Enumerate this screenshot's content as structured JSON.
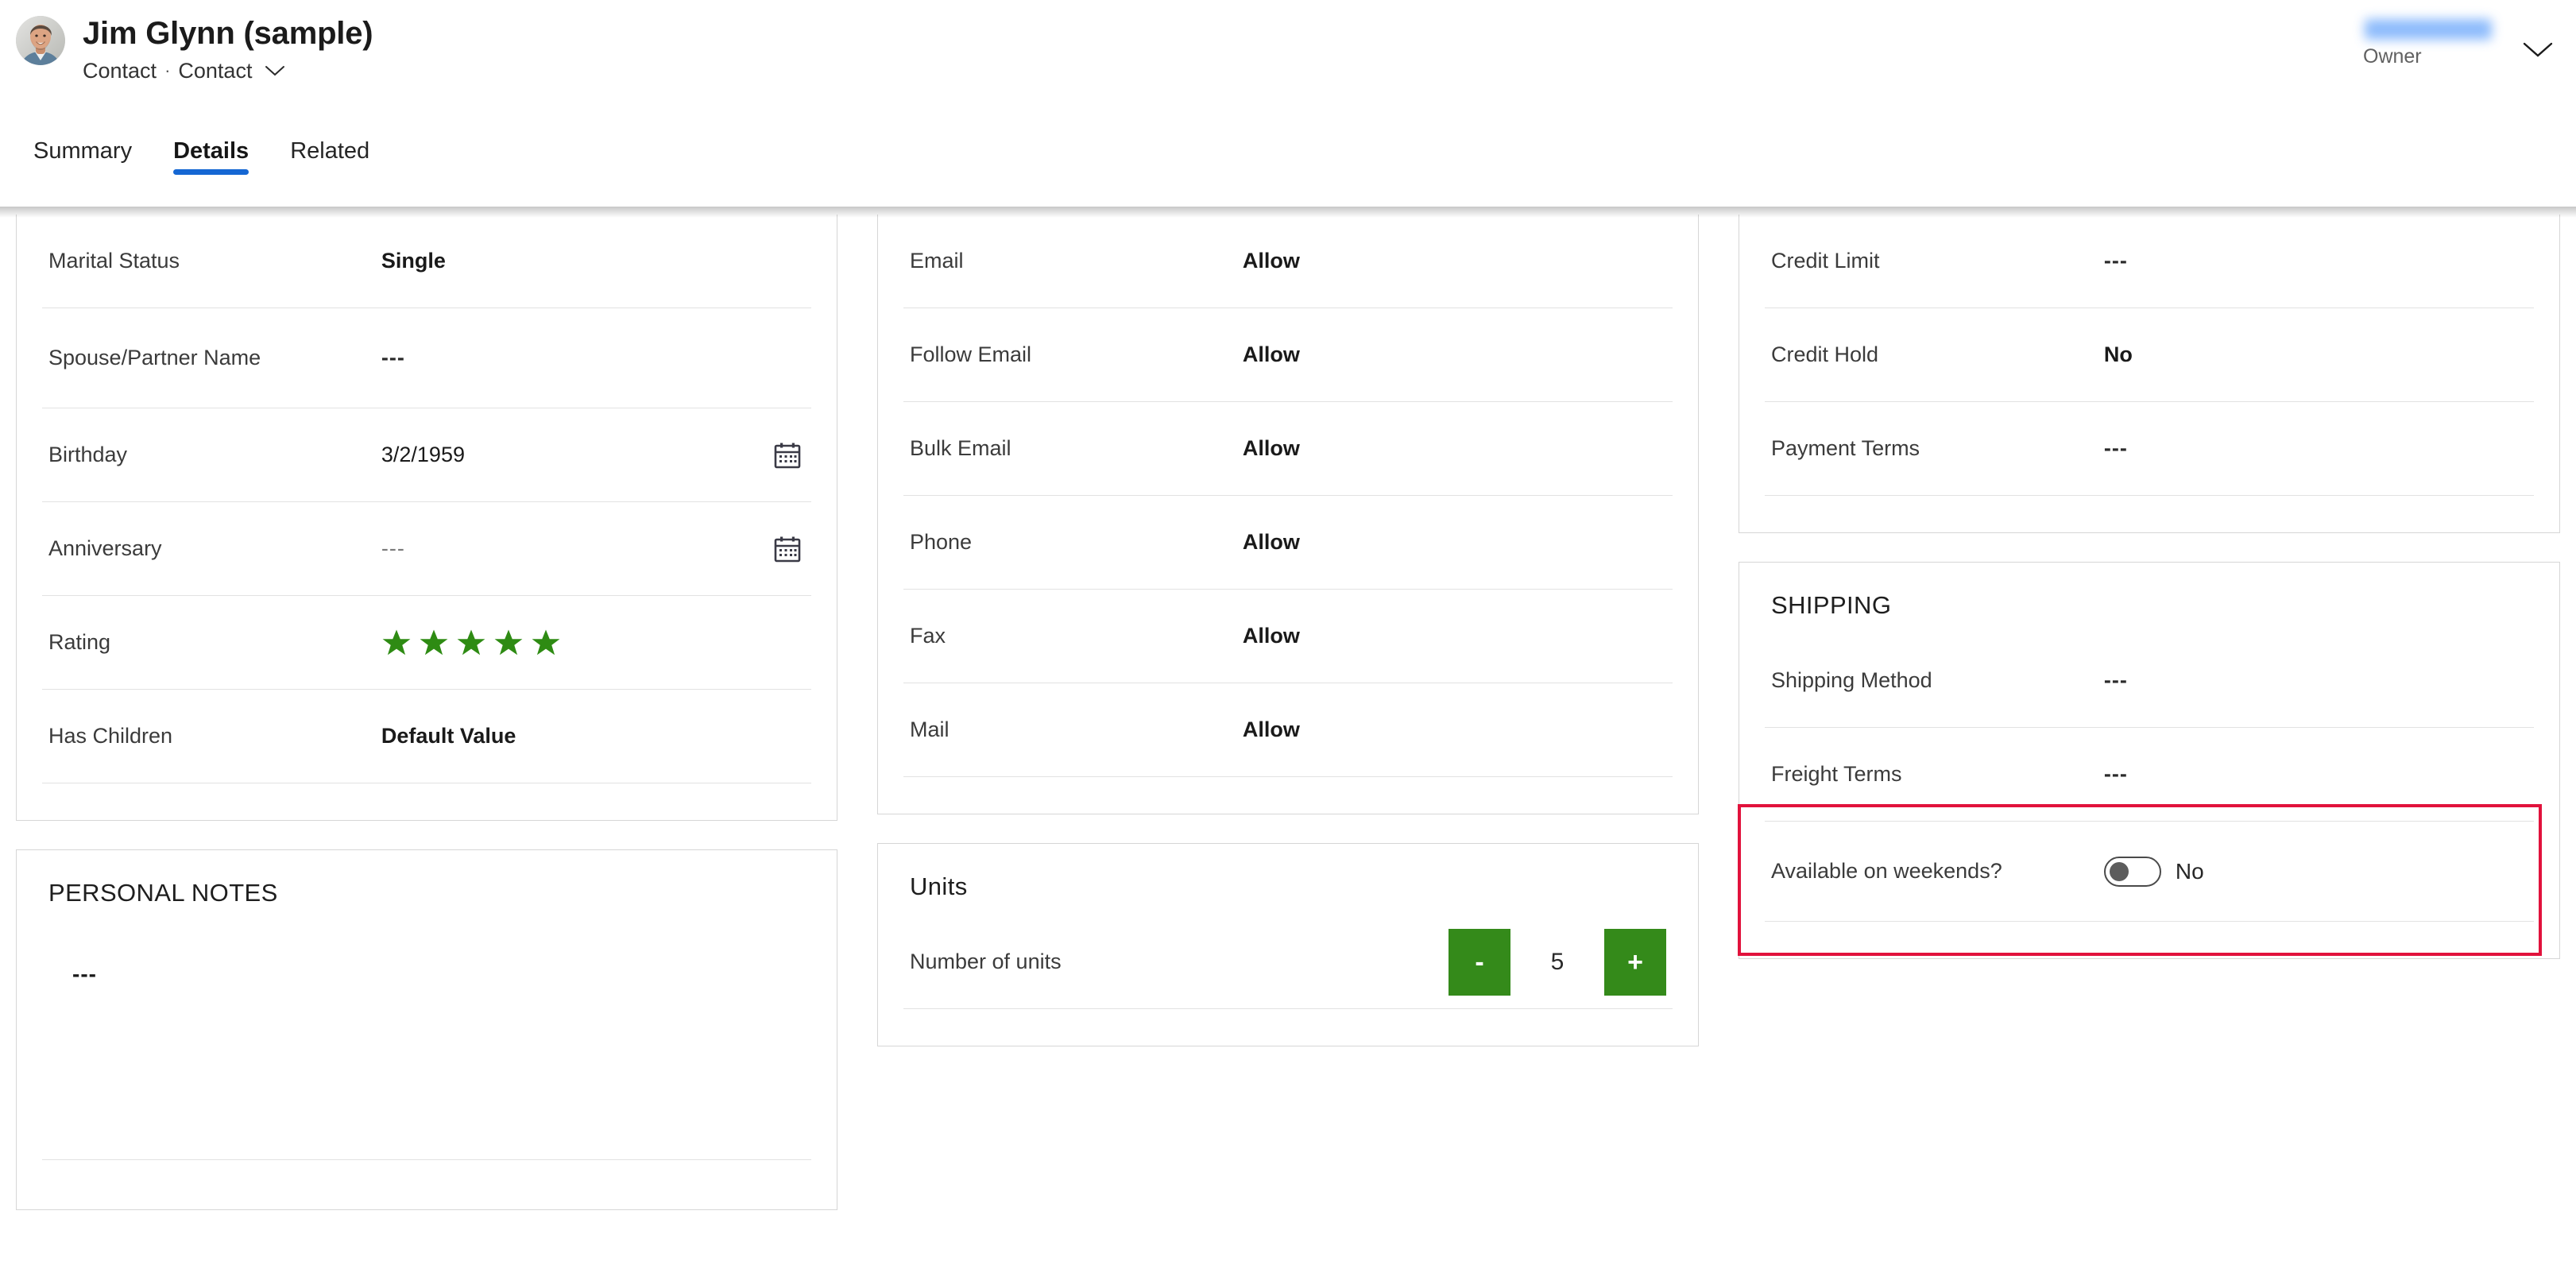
{
  "header": {
    "record_title": "Jim Glynn (sample)",
    "entity_type": "Contact",
    "form_name": "Contact",
    "separator": "·",
    "owner_label": "Owner",
    "owner_name_redacted": "",
    "chevron_icon": "chevron-down-icon"
  },
  "tabs": [
    {
      "label": "Summary",
      "active": false
    },
    {
      "label": "Details",
      "active": true
    },
    {
      "label": "Related",
      "active": false
    }
  ],
  "accent_colors": {
    "tab_underline": "#1567d3",
    "star_green": "#2e8b13",
    "stepper_green": "#348a1a",
    "highlight_red": "#e1123c",
    "owner_blur_blue": "#7ab0fb"
  },
  "columns": {
    "left": {
      "personal_card": {
        "fields": [
          {
            "label": "Marital Status",
            "value": "Single",
            "style": "bold"
          },
          {
            "label": "Spouse/Partner Name",
            "value": "---",
            "style": "dashes"
          },
          {
            "label": "Birthday",
            "value": "3/2/1959",
            "style": "plain",
            "trailing_icon": "calendar-icon"
          },
          {
            "label": "Anniversary",
            "value": "---",
            "style": "dim-dashes",
            "trailing_icon": "calendar-icon"
          },
          {
            "label": "Rating",
            "value": "",
            "style": "stars",
            "stars_filled": 5,
            "stars_total": 5
          },
          {
            "label": "Has Children",
            "value": "Default Value",
            "style": "bold"
          }
        ]
      },
      "notes_card": {
        "title": "PERSONAL NOTES",
        "value": "---"
      }
    },
    "middle": {
      "contact_prefs_card": {
        "fields": [
          {
            "label": "Email",
            "value": "Allow",
            "style": "bold"
          },
          {
            "label": "Follow Email",
            "value": "Allow",
            "style": "bold"
          },
          {
            "label": "Bulk Email",
            "value": "Allow",
            "style": "bold"
          },
          {
            "label": "Phone",
            "value": "Allow",
            "style": "bold"
          },
          {
            "label": "Fax",
            "value": "Allow",
            "style": "bold"
          },
          {
            "label": "Mail",
            "value": "Allow",
            "style": "bold"
          }
        ]
      },
      "units_card": {
        "title": "Units",
        "field_label": "Number of units",
        "decrement_label": "-",
        "value": "5",
        "increment_label": "+"
      }
    },
    "right": {
      "billing_card": {
        "fields": [
          {
            "label": "Credit Limit",
            "value": "---",
            "style": "dashes"
          },
          {
            "label": "Credit Hold",
            "value": "No",
            "style": "bold"
          },
          {
            "label": "Payment Terms",
            "value": "---",
            "style": "dashes"
          }
        ]
      },
      "shipping_card": {
        "title": "SHIPPING",
        "fields": [
          {
            "label": "Shipping Method",
            "value": "---",
            "style": "dashes"
          },
          {
            "label": "Freight Terms",
            "value": "---",
            "style": "dashes"
          }
        ],
        "toggle_field": {
          "label": "Available on weekends?",
          "state_label": "No",
          "on": false,
          "highlighted": true
        }
      }
    }
  }
}
